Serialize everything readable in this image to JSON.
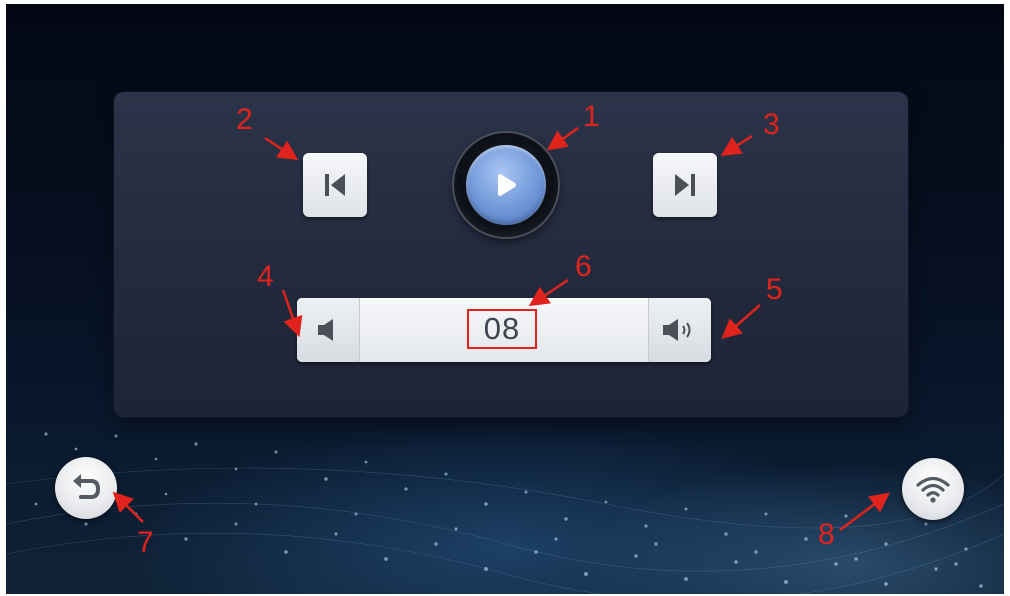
{
  "player": {
    "play_button": {
      "icon": "play-icon"
    },
    "prev_button": {
      "icon": "skip-previous-icon"
    },
    "next_button": {
      "icon": "skip-next-icon"
    },
    "volume": {
      "value": "08",
      "down_icon": "volume-down-icon",
      "up_icon": "volume-up-icon"
    }
  },
  "back_button": {
    "icon": "back-arrow-icon"
  },
  "wifi_button": {
    "icon": "wifi-icon"
  },
  "annotations": [
    "1",
    "2",
    "3",
    "4",
    "5",
    "6",
    "7",
    "8"
  ],
  "colors": {
    "annotation": "#e0231c",
    "play_blue": "#6f96d8",
    "panel": "#2a3145"
  }
}
